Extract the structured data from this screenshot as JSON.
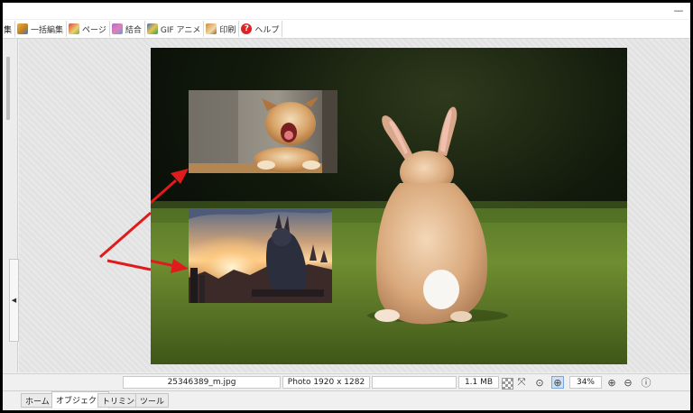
{
  "window": {
    "minimize_label": "—"
  },
  "toolbar": {
    "items": [
      {
        "label": "集",
        "icon": "none"
      },
      {
        "label": "一括編集",
        "icon": "batch-edit-icon"
      },
      {
        "label": "ページ",
        "icon": "page-icon"
      },
      {
        "label": "結合",
        "icon": "join-icon"
      },
      {
        "label": "GIF アニメ",
        "icon": "gif-animation-icon"
      },
      {
        "label": "印刷",
        "icon": "print-icon"
      },
      {
        "label": "ヘルプ",
        "icon": "help-icon",
        "glyph": "?"
      }
    ]
  },
  "left_panel": {
    "collapse_glyph": "◀"
  },
  "canvas": {
    "background": "photo of a rabbit on grass, seen from behind",
    "overlays": [
      "puppy-yawning-photo",
      "rabbit-warrior-sunset-artwork"
    ],
    "arrow_color": "#e01b1b"
  },
  "statusbar": {
    "filename": "25346389_m.jpg",
    "dimensions": "Photo 1920 x 1282",
    "empty_field": "",
    "filesize": "1.1 MB",
    "zoom": "34%",
    "icons": [
      "checkerboard-icon",
      "fit-screen-icon",
      "actual-size-icon",
      "zoom-fit-icon",
      "zoom-in-icon",
      "zoom-out-icon",
      "info-icon"
    ]
  },
  "tabs": [
    {
      "label": "ホーム",
      "active": false
    },
    {
      "label": "オブジェクト",
      "active": true
    },
    {
      "label": "トリミング",
      "active": false
    },
    {
      "label": "ツール",
      "active": false
    }
  ]
}
